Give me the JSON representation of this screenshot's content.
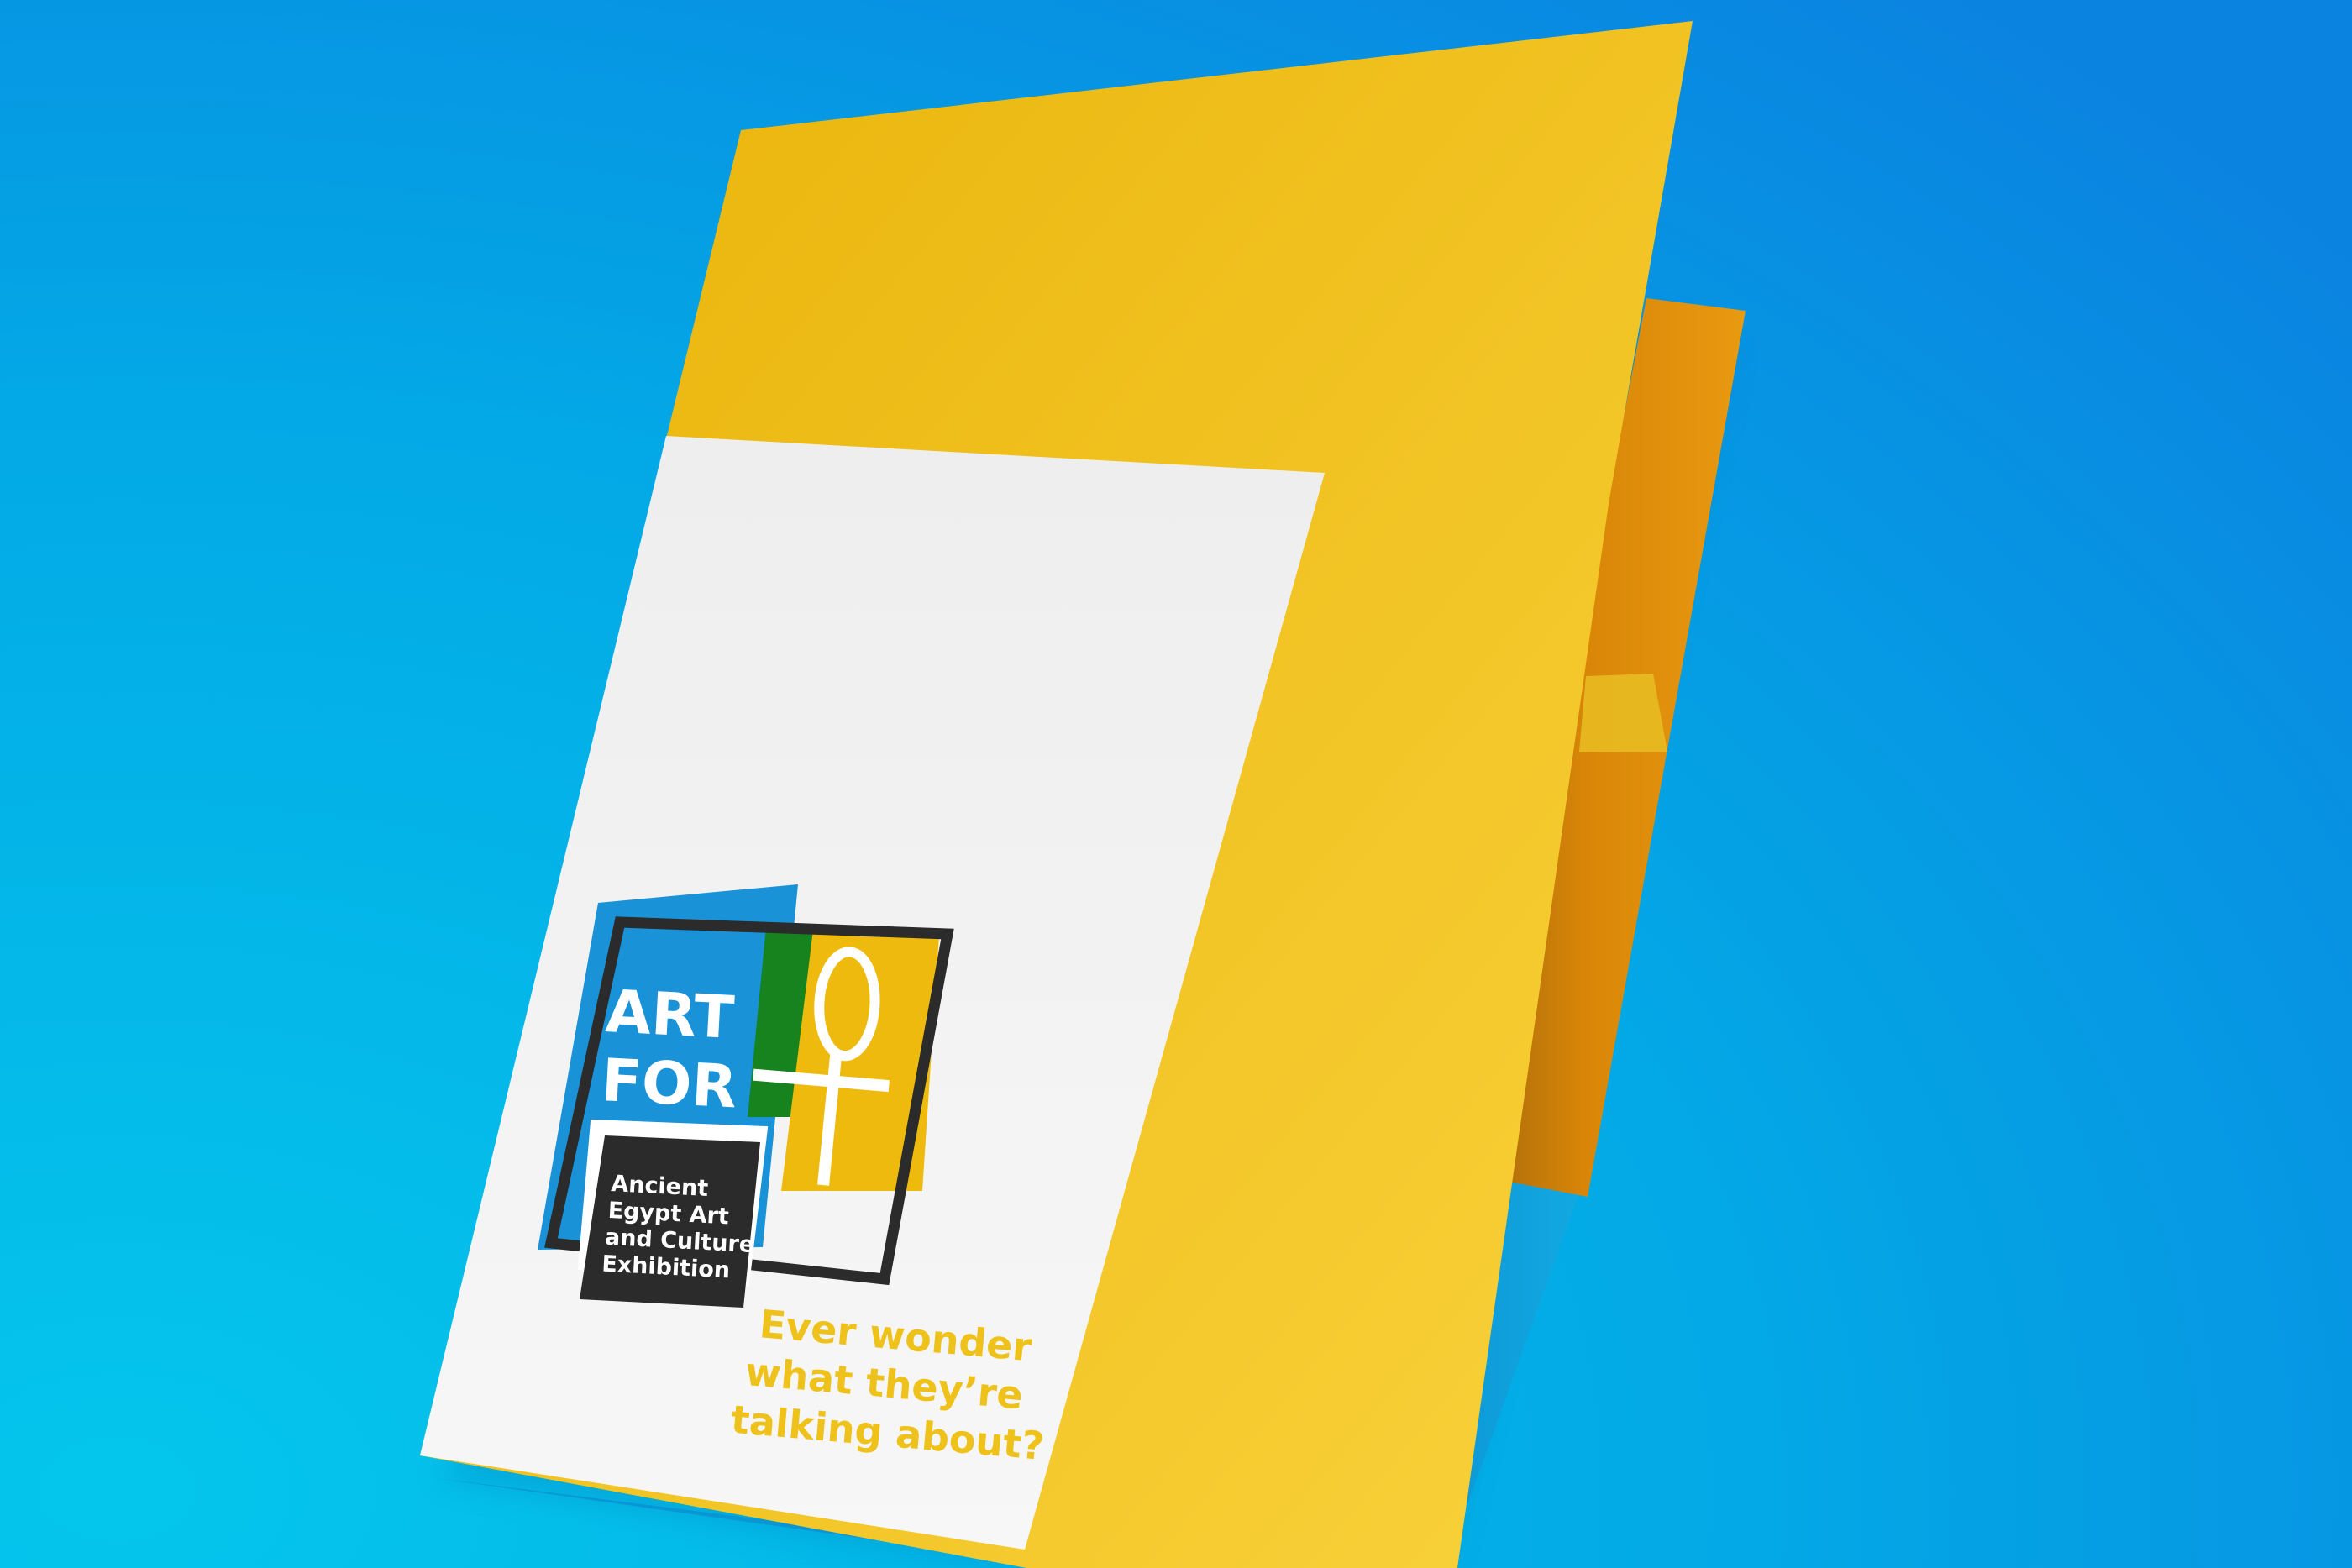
{
  "logo": {
    "line1": "ART",
    "line2": "FOR",
    "subtitle_lines": [
      "Ancient",
      "Egypt Art",
      "and Culture",
      "Exhibition"
    ]
  },
  "tagline": {
    "lines": [
      "Ever wonder",
      "what they’re",
      "talking about?"
    ]
  },
  "colors": {
    "background_top": "#0a8de2",
    "background_bottom": "#04c3ea",
    "folder_yellow": "#eeba0e",
    "folder_inner_orange": "#e08a0a",
    "label_white": "#f3f3f3",
    "logo_blue": "#1a92d8",
    "logo_green": "#16831f",
    "logo_yellow": "#eeba0e",
    "logo_dark": "#2b2b2b",
    "tagline_color": "#eec21a"
  },
  "icons": [
    "ankh-icon"
  ]
}
